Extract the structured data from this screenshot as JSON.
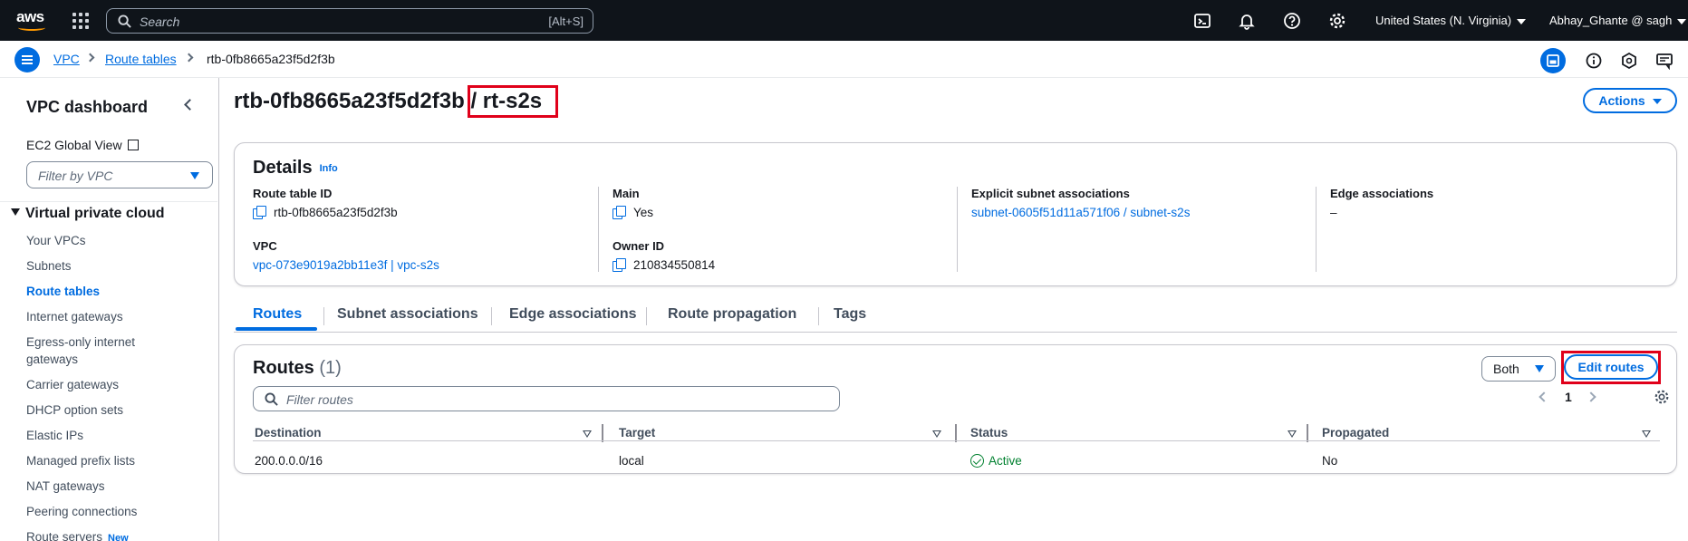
{
  "topnav": {
    "logo": "aws",
    "search_placeholder": "Search",
    "search_shortcut": "[Alt+S]",
    "icons": [
      "cloudshell-icon",
      "bell-icon",
      "help-icon",
      "settings-icon"
    ],
    "region": "United States (N. Virginia)",
    "user": "Abhay_Ghante @ sagh"
  },
  "breadcrumb": {
    "items": [
      "VPC",
      "Route tables",
      "rtb-0fb8665a23f5d2f3b"
    ]
  },
  "sidebar": {
    "title": "VPC dashboard",
    "ec2_global_view": "EC2 Global View",
    "filter_placeholder": "Filter by VPC",
    "section": "Virtual private cloud",
    "items": [
      {
        "label": "Your VPCs"
      },
      {
        "label": "Subnets"
      },
      {
        "label": "Route tables"
      },
      {
        "label": "Internet gateways"
      },
      {
        "label": "Egress-only internet"
      },
      {
        "label": "gateways"
      },
      {
        "label": "Carrier gateways"
      },
      {
        "label": "DHCP option sets"
      },
      {
        "label": "Elastic IPs"
      },
      {
        "label": "Managed prefix lists"
      },
      {
        "label": "NAT gateways"
      },
      {
        "label": "Peering connections"
      },
      {
        "label": "Route servers"
      }
    ],
    "active_item": "Route tables",
    "new_badge": "New"
  },
  "page": {
    "title_id": "rtb-0fb8665a23f5d2f3b",
    "title_name": "/ rt-s2s",
    "actions_label": "Actions"
  },
  "details": {
    "heading": "Details",
    "info": "Info",
    "route_table_id_label": "Route table ID",
    "route_table_id": "rtb-0fb8665a23f5d2f3b",
    "vpc_label": "VPC",
    "vpc": "vpc-073e9019a2bb11e3f | vpc-s2s",
    "main_label": "Main",
    "main": "Yes",
    "owner_id_label": "Owner ID",
    "owner_id": "210834550814",
    "explicit_label": "Explicit subnet associations",
    "explicit": "subnet-0605f51d11a571f06 / subnet-s2s",
    "edge_label": "Edge associations",
    "edge": "–"
  },
  "tabs": [
    "Routes",
    "Subnet associations",
    "Edge associations",
    "Route propagation",
    "Tags"
  ],
  "routes": {
    "title": "Routes",
    "count": "(1)",
    "filter_option": "Both",
    "edit_label": "Edit routes",
    "filter_placeholder": "Filter routes",
    "page": "1",
    "columns": [
      "Destination",
      "Target",
      "Status",
      "Propagated"
    ],
    "rows": [
      {
        "destination": "200.0.0.0/16",
        "target": "local",
        "status": "Active",
        "propagated": "No"
      }
    ]
  }
}
